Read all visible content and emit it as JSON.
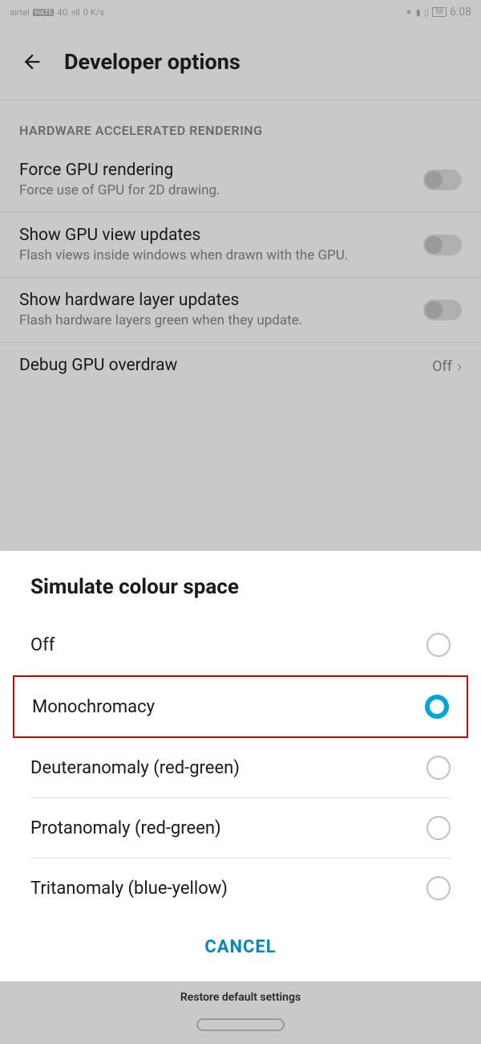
{
  "statusBar": {
    "carrier": "airtel",
    "volte": "VoLTE",
    "signal": "4G",
    "speed": "0 K/s",
    "battery": "58",
    "time": "6:08"
  },
  "header": {
    "title": "Developer options"
  },
  "section": {
    "label": "HARDWARE ACCELERATED RENDERING"
  },
  "settings": [
    {
      "title": "Force GPU rendering",
      "subtitle": "Force use of GPU for 2D drawing."
    },
    {
      "title": "Show GPU view updates",
      "subtitle": "Flash views inside windows when drawn with the GPU."
    },
    {
      "title": "Show hardware layer updates",
      "subtitle": "Flash hardware layers green when they update."
    }
  ],
  "overdraw": {
    "title": "Debug GPU overdraw",
    "value": "Off"
  },
  "dialog": {
    "title": "Simulate colour space",
    "options": [
      {
        "label": "Off"
      },
      {
        "label": "Monochromacy"
      },
      {
        "label": "Deuteranomaly (red-green)"
      },
      {
        "label": "Protanomaly (red-green)"
      },
      {
        "label": "Tritanomaly (blue-yellow)"
      }
    ],
    "cancel": "CANCEL"
  },
  "restore": {
    "text": "Restore default settings"
  }
}
